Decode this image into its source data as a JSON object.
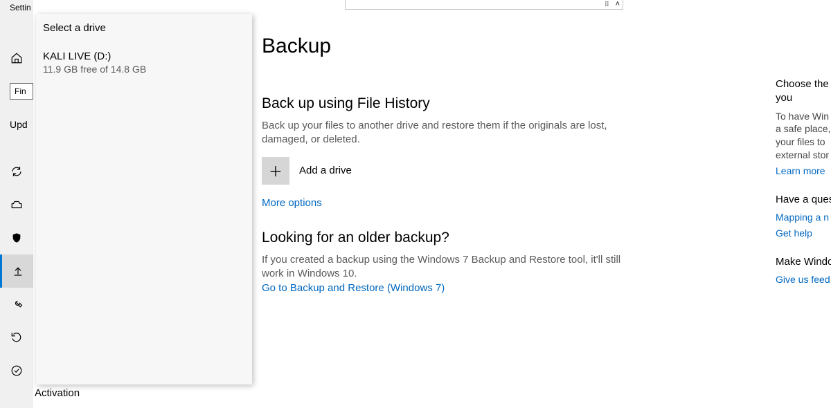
{
  "sidebar": {
    "app_title": "Settin",
    "find_placeholder": "Fin",
    "update_label": "Upd",
    "activation_label": "Activation"
  },
  "popup": {
    "title": "Select a drive",
    "drive": {
      "name": "KALI LIVE (D:)",
      "free": "11.9 GB free of 14.8 GB"
    }
  },
  "main": {
    "title": "Backup",
    "section1": {
      "heading": "Back up using File History",
      "desc": "Back up your files to another drive and restore them if the originals are lost, damaged, or deleted.",
      "add_label": "Add a drive",
      "more_options": "More options"
    },
    "section2": {
      "heading": "Looking for an older backup?",
      "desc": "If you created a backup using the Windows 7 Backup and Restore tool, it'll still work in Windows 10.",
      "link": "Go to Backup and Restore (Windows 7)"
    }
  },
  "right": {
    "choose_head": "Choose the",
    "choose_you": "you",
    "choose_body1": "To have Win",
    "choose_body2": "a safe place,",
    "choose_body3": "your files to",
    "choose_body4": "external stor",
    "learn_more": "Learn more",
    "question_head": "Have a ques",
    "mapping": "Mapping a n",
    "get_help": "Get help",
    "make_head": "Make Windo",
    "feedback": "Give us feed"
  }
}
